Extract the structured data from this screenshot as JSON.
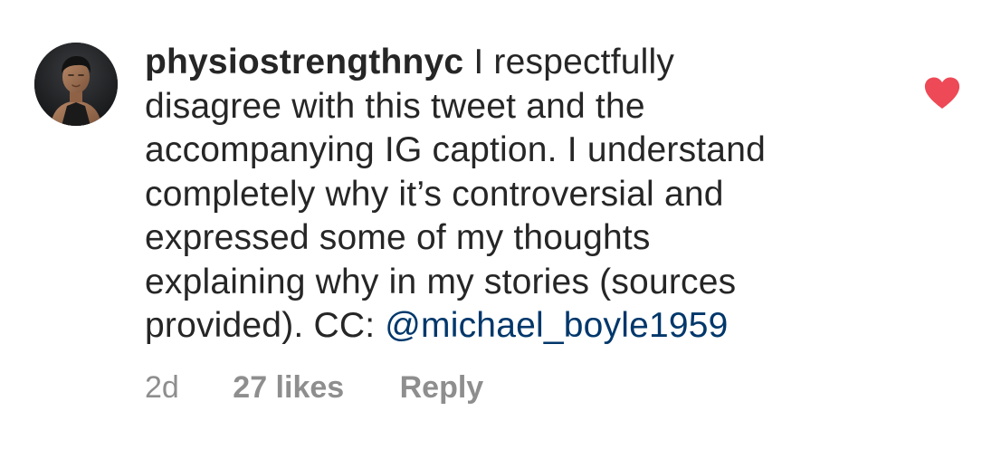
{
  "comment": {
    "username": "physiostrengthnyc",
    "text_lines": [
      "I respectfully",
      "disagree with this tweet and the",
      "accompanying IG caption. I understand",
      "completely why it’s controversial and",
      "expressed some of my thoughts",
      "explaining why in my stories (sources",
      "provided). CC: "
    ],
    "mention": "@michael_boyle1959",
    "timestamp": "2d",
    "likes_label": "27 likes",
    "reply_label": "Reply",
    "liked": true,
    "avatar_icon": "profile-photo",
    "like_icon": "heart-filled-icon"
  },
  "colors": {
    "text": "#262626",
    "secondary": "#8e8e8e",
    "mention": "#00376b",
    "heart": "#ed4956"
  }
}
